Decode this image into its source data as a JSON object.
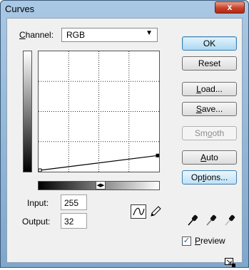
{
  "window": {
    "title": "Curves",
    "close_glyph": "x"
  },
  "channel": {
    "label_underlined": "C",
    "label_rest": "hannel:",
    "value": "RGB"
  },
  "input": {
    "label": "Input:",
    "value": "255"
  },
  "output": {
    "label": "Output:",
    "value": "32"
  },
  "buttons": {
    "ok": "OK",
    "reset": "Reset",
    "load_u": "L",
    "load_rest": "oad...",
    "save_u": "S",
    "save_rest": "ave...",
    "smooth_pre": "Sm",
    "smooth_u": "o",
    "smooth_rest": "oth",
    "auto_u": "A",
    "auto_rest": "uto",
    "options_pre": "Op",
    "options_u": "t",
    "options_rest": "ions..."
  },
  "preview": {
    "label_u": "P",
    "label_rest": "review",
    "checked": true
  },
  "curve": {
    "input_range": [
      0,
      255
    ],
    "output_range": [
      0,
      255
    ],
    "points": [
      [
        0,
        0
      ],
      [
        255,
        32
      ]
    ]
  },
  "icons": [
    "close-icon",
    "dropdown-arrow-icon",
    "ramp-toggle-icon",
    "curve-tool-icon",
    "pencil-tool-icon",
    "black-eyedropper-icon",
    "gray-eyedropper-icon",
    "white-eyedropper-icon",
    "expand-icon"
  ]
}
